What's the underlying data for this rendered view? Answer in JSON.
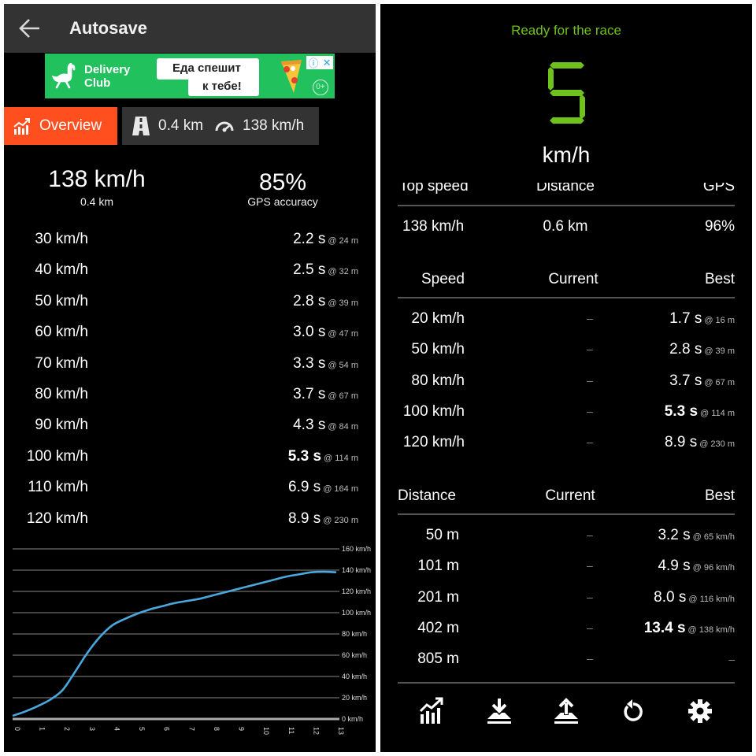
{
  "left": {
    "appbar": {
      "title": "Autosave",
      "back_icon": "arrow-left-icon"
    },
    "ad": {
      "brand_line1": "Delivery",
      "brand_line2": "Club",
      "text_line1": "Еда спешит",
      "text_line2": "к тебе!",
      "adchoices_info": "ⓘ",
      "adchoices_close": "✕",
      "age_rating": "0+",
      "bg_color": "#21c25e"
    },
    "tabs": {
      "overview": {
        "label": "Overview",
        "icon": "chart-trend-icon",
        "color": "#ff4f1f"
      },
      "run": {
        "distance": "0.4 km",
        "top_speed": "138 km/h",
        "road_icon": "road-icon",
        "speedometer_icon": "speedometer-icon"
      }
    },
    "summary": {
      "top_speed": "138 km/h",
      "distance": "0.4 km",
      "gps_value": "85%",
      "gps_label": "GPS accuracy"
    },
    "speed_times": [
      {
        "speed": "30 km/h",
        "time": "2.2",
        "unit": "s",
        "at": "@ 24 m",
        "best": false
      },
      {
        "speed": "40 km/h",
        "time": "2.5",
        "unit": "s",
        "at": "@ 32 m",
        "best": false
      },
      {
        "speed": "50 km/h",
        "time": "2.8",
        "unit": "s",
        "at": "@ 39 m",
        "best": false
      },
      {
        "speed": "60 km/h",
        "time": "3.0",
        "unit": "s",
        "at": "@ 47 m",
        "best": false
      },
      {
        "speed": "70 km/h",
        "time": "3.3",
        "unit": "s",
        "at": "@ 54 m",
        "best": false
      },
      {
        "speed": "80 km/h",
        "time": "3.7",
        "unit": "s",
        "at": "@ 67 m",
        "best": false
      },
      {
        "speed": "90 km/h",
        "time": "4.3",
        "unit": "s",
        "at": "@ 84 m",
        "best": false
      },
      {
        "speed": "100 km/h",
        "time": "5.3",
        "unit": "s",
        "at": "@ 114 m",
        "best": true
      },
      {
        "speed": "110 km/h",
        "time": "6.9",
        "unit": "s",
        "at": "@ 164 m",
        "best": false
      },
      {
        "speed": "120 km/h",
        "time": "8.9",
        "unit": "s",
        "at": "@ 230 m",
        "best": false
      }
    ]
  },
  "chart_data": {
    "type": "line",
    "title": "",
    "xlabel": "",
    "ylabel": "",
    "x_ticks": [
      "0",
      "1",
      "2",
      "3",
      "4",
      "5",
      "6",
      "7",
      "8",
      "9",
      "10",
      "11",
      "12",
      "13"
    ],
    "y_ticks": [
      "0 km/h",
      "20 km/h",
      "40 km/h",
      "60 km/h",
      "80 km/h",
      "100 km/h",
      "120 km/h",
      "140 km/h",
      "160 km/h"
    ],
    "xlim": [
      0,
      13
    ],
    "ylim": [
      0,
      160
    ],
    "grid": true,
    "y_axis_side": "right",
    "series": [
      {
        "name": "speed",
        "color": "#4aa8dd",
        "x": [
          0,
          0.5,
          1,
          1.5,
          2,
          2.5,
          3,
          3.5,
          4,
          4.5,
          5,
          5.5,
          6,
          6.5,
          7,
          7.5,
          8,
          8.5,
          9,
          9.5,
          10,
          10.5,
          11,
          11.5,
          12,
          12.5,
          13
        ],
        "y": [
          3,
          7,
          12,
          18,
          27,
          44,
          62,
          77,
          88,
          94,
          99,
          103,
          106,
          109,
          111,
          113,
          116,
          119,
          122,
          125,
          128,
          131,
          134,
          136,
          138,
          138.5,
          138
        ]
      }
    ]
  },
  "right": {
    "status": "Ready for the race",
    "current_speed": "5",
    "speed_unit": "km/h",
    "accent_color": "#6fc21c",
    "stats": {
      "headers": [
        "Top speed",
        "Distance",
        "GPS"
      ],
      "values": [
        "138 km/h",
        "0.6 km",
        "96%"
      ]
    },
    "speed_table": {
      "headers": [
        "Speed",
        "Current",
        "Best"
      ],
      "rows": [
        {
          "label": "20 km/h",
          "current": "–",
          "best": "1.7",
          "unit": "s",
          "at": "@ 16 m",
          "highlight": false
        },
        {
          "label": "50 km/h",
          "current": "–",
          "best": "2.8",
          "unit": "s",
          "at": "@ 39 m",
          "highlight": false
        },
        {
          "label": "80 km/h",
          "current": "–",
          "best": "3.7",
          "unit": "s",
          "at": "@ 67 m",
          "highlight": false
        },
        {
          "label": "100 km/h",
          "current": "–",
          "best": "5.3",
          "unit": "s",
          "at": "@ 114 m",
          "highlight": true
        },
        {
          "label": "120 km/h",
          "current": "–",
          "best": "8.9",
          "unit": "s",
          "at": "@ 230 m",
          "highlight": false
        }
      ]
    },
    "distance_table": {
      "headers": [
        "Distance",
        "Current",
        "Best"
      ],
      "rows": [
        {
          "label": "50 m",
          "current": "–",
          "best": "3.2",
          "unit": "s",
          "at": "@ 65 km/h",
          "highlight": false
        },
        {
          "label": "101 m",
          "current": "–",
          "best": "4.9",
          "unit": "s",
          "at": "@ 96 km/h",
          "highlight": false
        },
        {
          "label": "201 m",
          "current": "–",
          "best": "8.0",
          "unit": "s",
          "at": "@ 116 km/h",
          "highlight": false
        },
        {
          "label": "402 m",
          "current": "–",
          "best": "13.4",
          "unit": "s",
          "at": "@ 138 km/h",
          "highlight": true
        },
        {
          "label": "805 m",
          "current": "–",
          "best": "–",
          "unit": "",
          "at": "",
          "highlight": false
        }
      ]
    },
    "toolbar": [
      {
        "name": "statistics",
        "icon": "chart-trend-icon"
      },
      {
        "name": "import",
        "icon": "download-tray-icon"
      },
      {
        "name": "export",
        "icon": "upload-tray-icon"
      },
      {
        "name": "reset",
        "icon": "reset-icon"
      },
      {
        "name": "settings",
        "icon": "gear-icon"
      }
    ]
  }
}
